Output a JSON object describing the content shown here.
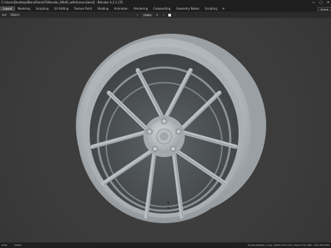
{
  "window": {
    "title": "C:\\Users\\Desktop\\BlendFiles\\07\\Blender_MS4R_withScene.blend] - Blender 4.2.1 LTS",
    "buttons": [
      "—",
      "▢",
      "✕"
    ]
  },
  "workspaces": {
    "tabs": [
      "Layout",
      "Modeling",
      "Sculpting",
      "UV Editing",
      "Texture Paint",
      "Shading",
      "Animation",
      "Rendering",
      "Compositing",
      "Geometry Nodes",
      "Scripting"
    ],
    "active": "Layout",
    "add_label": "+"
  },
  "scene_selector": {
    "label": "Scene"
  },
  "viewport_header": {
    "items": [
      "ect",
      "Object"
    ],
    "transform_orientation": "Global"
  },
  "status_bar": {
    "left": [
      "View",
      "Select"
    ],
    "right": "Scene.wheels | Cup | Verts 232,104 | Faces 231,982 | Tris 463,964"
  },
  "colors": {
    "background": "#3d3d3d",
    "title_bar": "#1f1f1f",
    "header": "#2a2a2a",
    "wheel": "#b6bcc0"
  },
  "icons": [
    "minimize-icon",
    "maximize-icon",
    "close-icon",
    "cursor-icon",
    "wheel-model"
  ]
}
